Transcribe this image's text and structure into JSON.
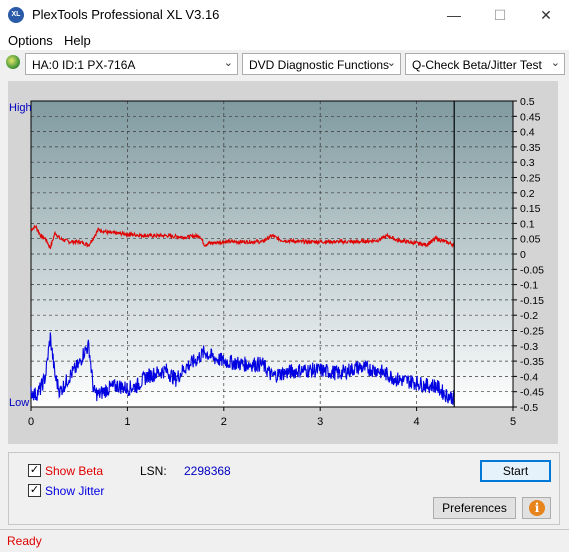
{
  "window": {
    "app_icon": "XL",
    "title": "PlexTools Professional XL V3.16",
    "minimize_icon": "—",
    "maximize_icon": "☐",
    "close_icon": "✕"
  },
  "menu": {
    "options": "Options",
    "help": "Help"
  },
  "toolbar": {
    "drive": "HA:0 ID:1  PX-716A",
    "function": "DVD Diagnostic Functions",
    "test": "Q-Check Beta/Jitter Test",
    "dropdown_arrow": "⌄"
  },
  "chart_data": {
    "type": "line",
    "x_ticks": [
      "0",
      "1",
      "2",
      "3",
      "4",
      "5"
    ],
    "xlim": [
      0,
      5
    ],
    "right_ticks": [
      "0.5",
      "0.45",
      "0.4",
      "0.35",
      "0.3",
      "0.25",
      "0.2",
      "0.15",
      "0.1",
      "0.05",
      "0",
      "-0.05",
      "-0.1",
      "-0.15",
      "-0.2",
      "-0.25",
      "-0.3",
      "-0.35",
      "-0.4",
      "-0.45",
      "-0.5"
    ],
    "ylim": [
      -0.5,
      0.5
    ],
    "left_labels": {
      "high": "High",
      "low": "Low"
    },
    "end_marker_x": 4.39,
    "grid": true,
    "colors": {
      "beta": "#e00000",
      "jitter": "#0000e0",
      "bg_top": "#7f9aa0",
      "bg_bottom": "#ffffff",
      "label_blue": "#0000c0"
    },
    "series": [
      {
        "name": "Beta",
        "x": [
          0,
          0.05,
          0.1,
          0.15,
          0.2,
          0.25,
          0.3,
          0.4,
          0.5,
          0.6,
          0.7,
          0.8,
          1.0,
          1.2,
          1.4,
          1.6,
          1.75,
          1.8,
          1.85,
          2.0,
          2.2,
          2.4,
          2.5,
          2.6,
          2.8,
          3.0,
          3.2,
          3.4,
          3.6,
          3.7,
          3.8,
          4.0,
          4.1,
          4.2,
          4.3,
          4.39
        ],
        "y": [
          0.08,
          0.09,
          0.06,
          0.05,
          0.02,
          0.07,
          0.05,
          0.04,
          0.04,
          0.03,
          0.08,
          0.07,
          0.065,
          0.06,
          0.06,
          0.055,
          0.06,
          0.03,
          0.035,
          0.04,
          0.04,
          0.04,
          0.06,
          0.045,
          0.04,
          0.04,
          0.04,
          0.04,
          0.045,
          0.06,
          0.045,
          0.035,
          0.03,
          0.05,
          0.04,
          0.03
        ]
      },
      {
        "name": "Jitter",
        "x": [
          0,
          0.05,
          0.1,
          0.15,
          0.2,
          0.25,
          0.3,
          0.4,
          0.5,
          0.55,
          0.6,
          0.65,
          0.7,
          0.8,
          0.9,
          1.0,
          1.1,
          1.2,
          1.3,
          1.4,
          1.5,
          1.6,
          1.7,
          1.8,
          1.9,
          2.0,
          2.2,
          2.4,
          2.5,
          2.6,
          2.8,
          3.0,
          3.2,
          3.4,
          3.6,
          3.8,
          4.0,
          4.1,
          4.2,
          4.3,
          4.39
        ],
        "y": [
          -0.45,
          -0.46,
          -0.44,
          -0.4,
          -0.27,
          -0.4,
          -0.45,
          -0.4,
          -0.36,
          -0.32,
          -0.3,
          -0.45,
          -0.46,
          -0.44,
          -0.43,
          -0.44,
          -0.43,
          -0.4,
          -0.39,
          -0.38,
          -0.41,
          -0.37,
          -0.35,
          -0.32,
          -0.34,
          -0.35,
          -0.36,
          -0.36,
          -0.4,
          -0.39,
          -0.38,
          -0.38,
          -0.39,
          -0.37,
          -0.38,
          -0.41,
          -0.42,
          -0.43,
          -0.43,
          -0.46,
          -0.47
        ]
      }
    ]
  },
  "bottom": {
    "show_beta": "Show Beta",
    "show_beta_checked": true,
    "show_jitter": "Show Jitter",
    "show_jitter_checked": true,
    "check_mark": "✓",
    "lsn_label": "LSN:",
    "lsn_value": "2298368",
    "start_button": "Start",
    "preferences_button": "Preferences",
    "info_icon": "i"
  },
  "status": {
    "text": "Ready"
  }
}
